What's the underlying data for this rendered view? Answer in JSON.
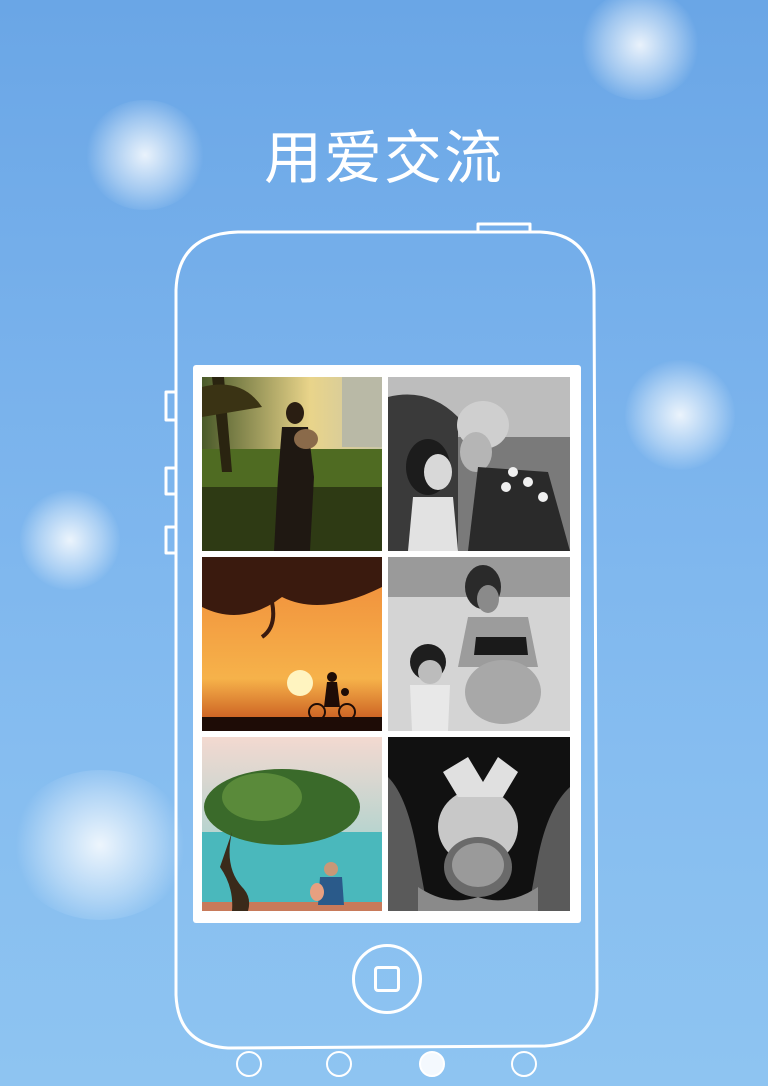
{
  "title": "用爱交流",
  "gallery": {
    "photos": [
      {
        "icon": "mother-baby-sunset-photo-icon"
      },
      {
        "icon": "grandmother-child-kiss-photo-icon"
      },
      {
        "icon": "family-bicycle-sunset-photo-icon"
      },
      {
        "icon": "pregnant-mother-daughter-photo-icon"
      },
      {
        "icon": "father-child-tree-sea-photo-icon"
      },
      {
        "icon": "baby-hands-photo-icon"
      }
    ]
  },
  "pager": {
    "count": 4,
    "active_index": 2
  },
  "colors": {
    "background": "#79b2ec",
    "foreground": "#ffffff"
  }
}
